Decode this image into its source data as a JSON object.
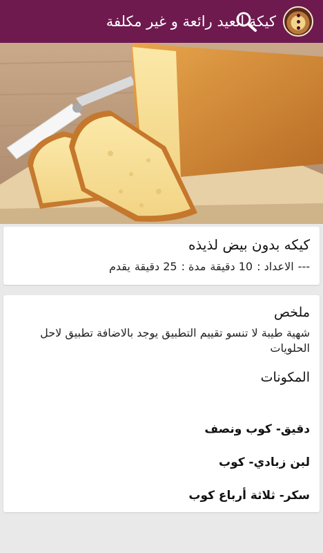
{
  "app_bar": {
    "title": "كيكة العيد رائعة و غير مكلفة",
    "avatar_icon": "cake-icon",
    "search_icon": "search-icon",
    "menu_icon": "more-vert-icon",
    "color": "#6e1a4f"
  },
  "hero_image": {
    "subject": "pound-cake-image"
  },
  "recipe": {
    "name": "كيكه بدون بيض لذيذه",
    "meta": {
      "prefix": "---",
      "prep_label": "الاعداد :",
      "prep_value": "10 دقيقة",
      "cook_label": "مدة :",
      "cook_value": "25 دقيقة",
      "serves_label": "يقدم"
    }
  },
  "details": {
    "summary_heading": "ملخص",
    "summary_text": "شهية طيبة لا تنسو تقييم التطبيق يوجد بالاضافة تطبيق لاحل الحلويات",
    "ingredients_heading": "المكونات",
    "ingredients": [
      "دقيق- كوب ونصف",
      "لبن زبادي- كوب",
      "سكر- ثلاثة أرباع كوب"
    ]
  }
}
